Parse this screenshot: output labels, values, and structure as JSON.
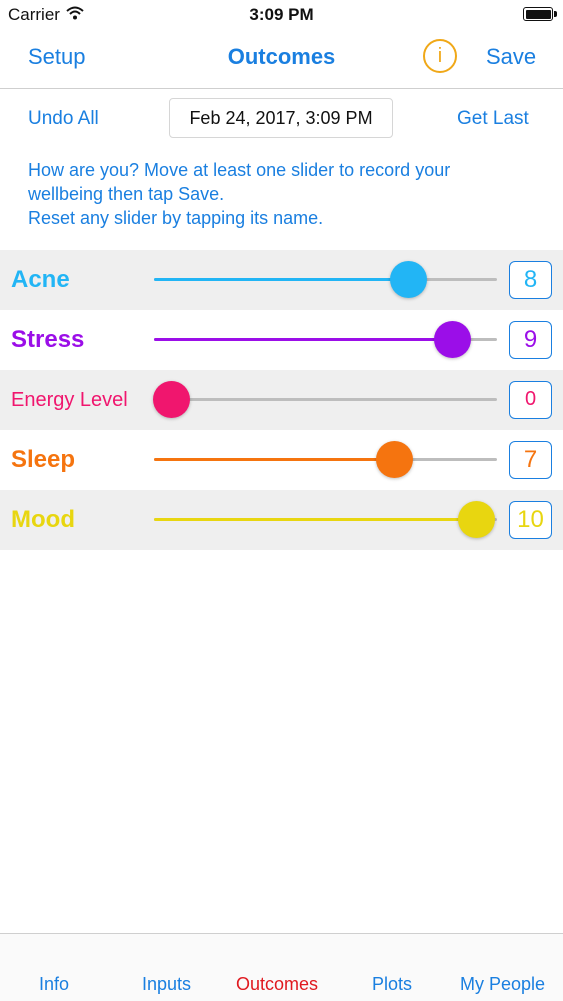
{
  "status_bar": {
    "carrier": "Carrier",
    "time": "3:09 PM"
  },
  "nav": {
    "left": "Setup",
    "title": "Outcomes",
    "info": "i",
    "right": "Save"
  },
  "toolbar": {
    "undo": "Undo All",
    "date": "Feb 24, 2017, 3:09 PM",
    "get_last": "Get Last"
  },
  "instructions": [
    "How are you? Move at least one slider to record your",
    "wellbeing then tap Save.",
    "Reset any slider by tapping its name."
  ],
  "sliders": [
    {
      "name": "Acne",
      "value": "8",
      "fraction": 0.74,
      "color": "#22b5f5",
      "shaded": true,
      "small": false
    },
    {
      "name": "Stress",
      "value": "9",
      "fraction": 0.87,
      "color": "#9b0ee8",
      "shaded": false,
      "small": false
    },
    {
      "name": "Energy Level",
      "value": "0",
      "fraction": 0.05,
      "color": "#f0166e",
      "shaded": true,
      "small": true
    },
    {
      "name": "Sleep",
      "value": "7",
      "fraction": 0.7,
      "color": "#f5740f",
      "shaded": false,
      "small": false
    },
    {
      "name": "Mood",
      "value": "10",
      "fraction": 0.94,
      "color": "#e8d610",
      "shaded": true,
      "small": false
    }
  ],
  "tabs": [
    {
      "label": "Info",
      "active": false
    },
    {
      "label": "Inputs",
      "active": false
    },
    {
      "label": "Outcomes",
      "active": true
    },
    {
      "label": "Plots",
      "active": false
    },
    {
      "label": "My People",
      "active": false
    }
  ],
  "colors": {
    "accent": "#1a7fe0",
    "info": "#f0a818",
    "active_tab": "#e0191f"
  }
}
